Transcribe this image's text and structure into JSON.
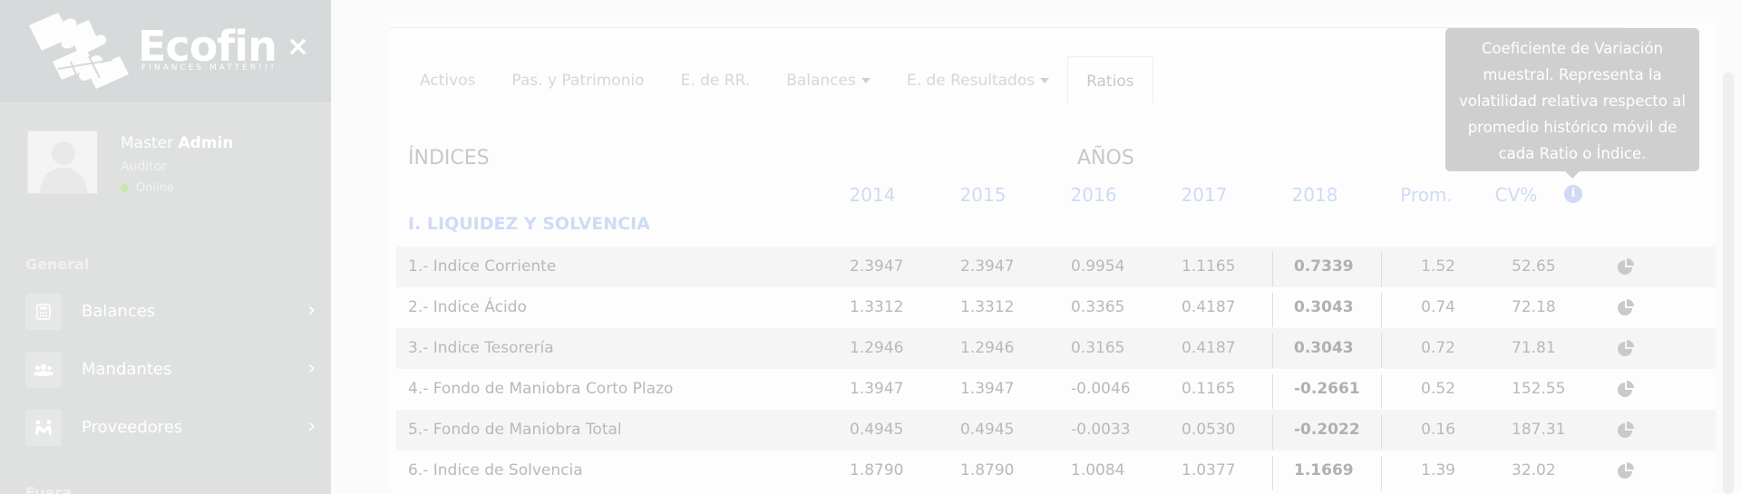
{
  "sidebar": {
    "brand": {
      "name": "Ecofin",
      "tagline": "FINANCES MATTER!!!"
    },
    "close_symbol": "×",
    "user": {
      "first": "Master",
      "last": "Admin",
      "role": "Auditor",
      "status": "Online"
    },
    "section_general": "General",
    "section_second": "Fuera",
    "items": [
      {
        "label": "Balances",
        "icon": "calculator-icon"
      },
      {
        "label": "Mandantes",
        "icon": "users-icon"
      },
      {
        "label": "Proveedores",
        "icon": "handshake-icon"
      }
    ],
    "chevron": "›"
  },
  "tabs": [
    {
      "label": "Activos",
      "dropdown": false,
      "active": false
    },
    {
      "label": "Pas. y Patrimonio",
      "dropdown": false,
      "active": false
    },
    {
      "label": "E. de RR.",
      "dropdown": false,
      "active": false
    },
    {
      "label": "Balances",
      "dropdown": true,
      "active": false
    },
    {
      "label": "E. de Resultados",
      "dropdown": true,
      "active": false
    },
    {
      "label": "Ratios",
      "dropdown": false,
      "active": true
    }
  ],
  "table": {
    "heading_indices": "ÍNDICES",
    "heading_years": "AÑOS",
    "columns": [
      "2014",
      "2015",
      "2016",
      "2017",
      "2018",
      "Prom.",
      "CV%"
    ],
    "section": "I. LIQUIDEZ Y SOLVENCIA",
    "rows": [
      {
        "name": "1.- Indice Corriente",
        "v2014": "2.3947",
        "v2015": "2.3947",
        "v2016": "0.9954",
        "v2017": "1.1165",
        "v2018": "0.7339",
        "prom": "1.52",
        "cv": "52.65"
      },
      {
        "name": "2.- Indice Ácido",
        "v2014": "1.3312",
        "v2015": "1.3312",
        "v2016": "0.3365",
        "v2017": "0.4187",
        "v2018": "0.3043",
        "prom": "0.74",
        "cv": "72.18"
      },
      {
        "name": "3.- Indice Tesorería",
        "v2014": "1.2946",
        "v2015": "1.2946",
        "v2016": "0.3165",
        "v2017": "0.4187",
        "v2018": "0.3043",
        "prom": "0.72",
        "cv": "71.81"
      },
      {
        "name": "4.- Fondo de Maniobra Corto Plazo",
        "v2014": "1.3947",
        "v2015": "1.3947",
        "v2016": "-0.0046",
        "v2017": "0.1165",
        "v2018": "-0.2661",
        "prom": "0.52",
        "cv": "152.55"
      },
      {
        "name": "5.- Fondo de Maniobra Total",
        "v2014": "0.4945",
        "v2015": "0.4945",
        "v2016": "-0.0033",
        "v2017": "0.0530",
        "v2018": "-0.2022",
        "prom": "0.16",
        "cv": "187.31"
      },
      {
        "name": "6.- Indice de Solvencia",
        "v2014": "1.8790",
        "v2015": "1.8790",
        "v2016": "1.0084",
        "v2017": "1.0377",
        "v2018": "1.1669",
        "prom": "1.39",
        "cv": "32.02"
      }
    ]
  },
  "tooltip": {
    "text": "Coeficiente de Variación muestral. Representa la volatilidad relativa respecto al promedio histórico móvil de cada Ratio o Índice."
  },
  "info_symbol": "i",
  "colors": {
    "sidebar_bg": "#dfe1e1",
    "accent_blue": "#cfdaf5",
    "tooltip_bg": "#cfcfcf"
  }
}
